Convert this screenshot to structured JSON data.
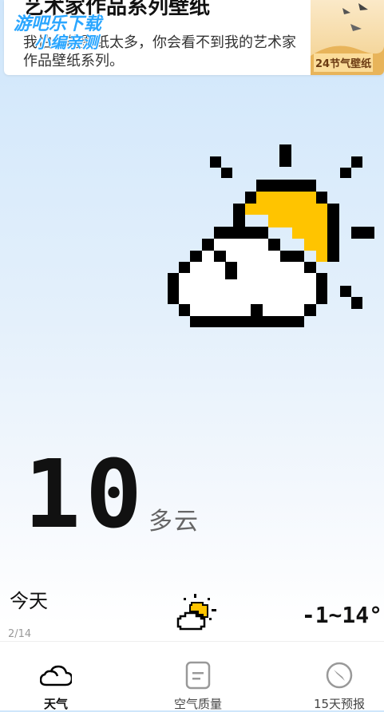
{
  "banner": {
    "title": "艺术家作品系列壁纸",
    "description": "我怕你的壁纸太多，你会看不到我的艺术家作品壁纸系列。",
    "thumbnail_label": "24节气壁纸",
    "watermark_line1": "游吧乐下载",
    "watermark_line2": "小编亲测"
  },
  "current": {
    "temperature": "10",
    "condition": "多云"
  },
  "today": {
    "label": "今天",
    "range": "-1~14°",
    "icon": "partly-cloudy-icon"
  },
  "pager": {
    "indicator": "2/14"
  },
  "tabs": [
    {
      "label": "天气",
      "icon": "cloud-icon"
    },
    {
      "label": "空气质量",
      "icon": "document-icon"
    },
    {
      "label": "15天预报",
      "icon": "compass-icon"
    }
  ],
  "colors": {
    "sun": "#ffc400",
    "accent_watermark": "#2aa6ff",
    "text": "#111111"
  }
}
